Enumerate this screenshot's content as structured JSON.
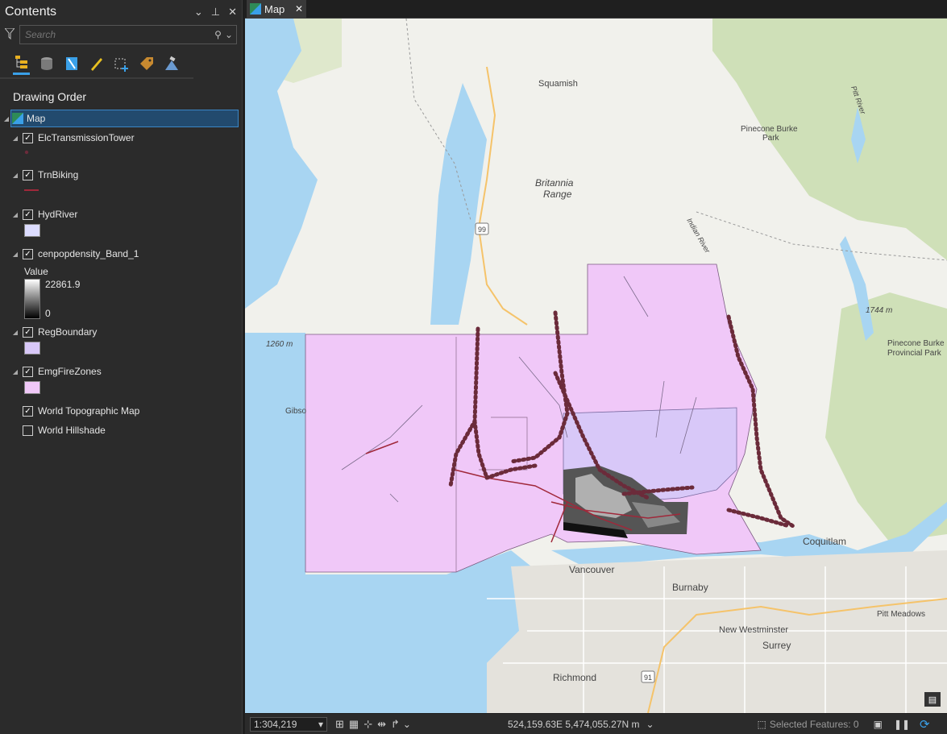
{
  "contents": {
    "title": "Contents",
    "search_placeholder": "Search",
    "section": "Drawing Order",
    "map_node": "Map",
    "layers": [
      {
        "name": "ElcTransmissionTower",
        "checked": true
      },
      {
        "name": "TrnBiking",
        "checked": true
      },
      {
        "name": "HydRiver",
        "checked": true
      },
      {
        "name": "cenpopdensity_Band_1",
        "checked": true
      },
      {
        "name": "RegBoundary",
        "checked": true
      },
      {
        "name": "EmgFireZones",
        "checked": true
      },
      {
        "name": "World Topographic Map",
        "checked": true
      },
      {
        "name": "World Hillshade",
        "checked": false
      }
    ],
    "raster_legend": {
      "heading": "Value",
      "high": "22861.9",
      "low": "0"
    },
    "colors": {
      "accent": "#3aa0e8",
      "fire_zone": "#f0c8f8",
      "reg_boundary": "#d8c8f8",
      "river": "#dcdcff",
      "transmission": "#6b2b3a",
      "biking": "#a0283a"
    }
  },
  "map_tab": {
    "label": "Map"
  },
  "map_labels": {
    "squamish": "Squamish",
    "britannia": "Britannia",
    "range": "Range",
    "pinecone_burke": "Pinecone Burke",
    "park": "Park",
    "pinecone_burke_prov": "Pinecone Burke",
    "provincial_park": "Provincial Park",
    "elev_1744": "1744 m",
    "elev_1260": "1260 m",
    "gibsons": "Gibso",
    "vancouver": "Vancouver",
    "burnaby": "Burnaby",
    "coquitlam": "Coquitlam",
    "new_westminster": "New Westminster",
    "surrey": "Surrey",
    "richmond": "Richmond",
    "pitt_meadows": "Pitt Meadows",
    "pitt_river": "Pitt River",
    "hwy_99": "99",
    "hwy_91": "91",
    "indian_river": "Indian River"
  },
  "status_bar": {
    "scale": "1:304,219",
    "coordinates": "524,159.63E 5,474,055.27N m",
    "selected": "Selected Features: 0"
  }
}
